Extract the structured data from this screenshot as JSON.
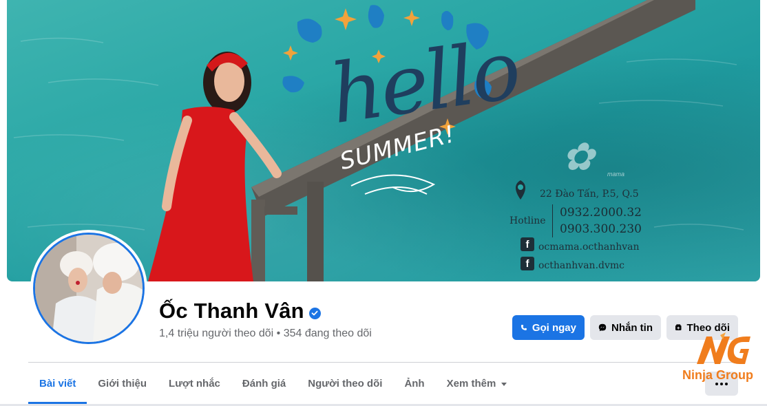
{
  "cover": {
    "hello": "hello",
    "summer": "SUMMER!",
    "brand_sub": "mama",
    "address": "22 Đào Tấn, P.5, Q.5",
    "hotline_label": "Hotline",
    "phone_1": "0932.2000.32",
    "phone_2": "0903.300.230",
    "facebook_1": "ocmama.octhanhvan",
    "facebook_2": "octhanhvan.dvmc"
  },
  "profile": {
    "name": "Ốc Thanh Vân",
    "stats": "1,4 triệu người theo dõi • 354 đang theo dõi"
  },
  "actions": {
    "call": "Gọi ngay",
    "message": "Nhắn tin",
    "follow": "Theo dõi"
  },
  "tabs": [
    {
      "label": "Bài viết",
      "active": true
    },
    {
      "label": "Giới thiệu"
    },
    {
      "label": "Lượt nhắc"
    },
    {
      "label": "Đánh giá"
    },
    {
      "label": "Người theo dõi"
    },
    {
      "label": "Ảnh"
    },
    {
      "label": "Xem thêm"
    }
  ],
  "watermark": {
    "text": "Ninja Group"
  },
  "colors": {
    "accent": "#1b74e4",
    "watermark": "#f07d1d"
  }
}
